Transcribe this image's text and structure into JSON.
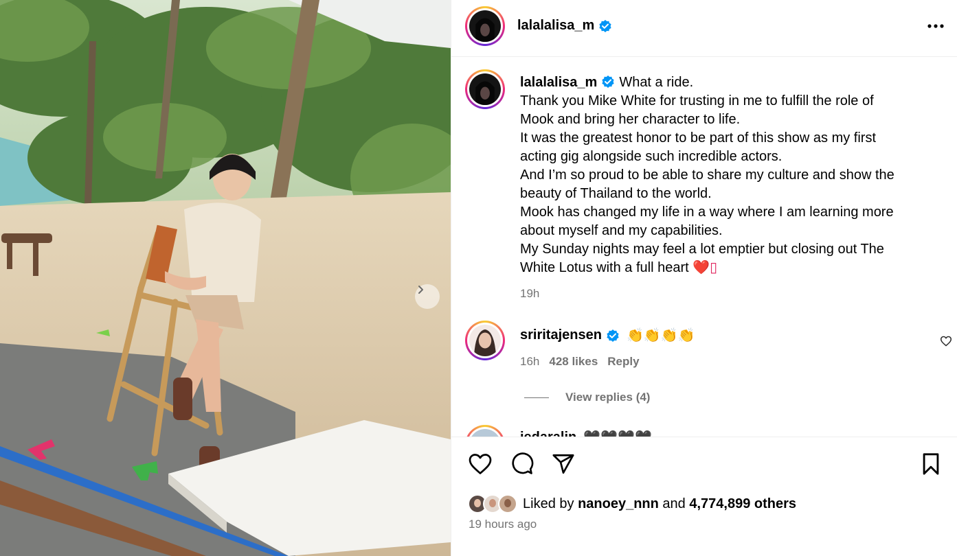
{
  "post": {
    "author": "lalalalisa_m",
    "caption_lines": [
      "What a ride.",
      "Thank you Mike White for trusting in me to fulfill the role of",
      "Mook and bring her character to life.",
      "It was the greatest honor to be part of this show as my first",
      "acting gig alongside such incredible actors.",
      "And I’m so proud to be able to share my culture and show the",
      "beauty of Thailand to the world.",
      "Mook has changed my life in a way where I am learning more",
      "about myself and my capabilities.",
      "My Sunday nights may feel a lot emptier but closing out The",
      "White Lotus with a full heart"
    ],
    "caption_tail": "❤️▯",
    "caption_time": "19h"
  },
  "comments": [
    {
      "username": "sriritajensen",
      "text": "👏👏👏👏",
      "time": "16h",
      "likes": "428 likes",
      "reply_label": "Reply",
      "view_replies": "View replies (4)"
    },
    {
      "username": "jedaralin",
      "text": "🖤🖤🖤🖤"
    }
  ],
  "footer": {
    "liked_by_prefix": "Liked by",
    "liked_by_user": "nanoey_nnn",
    "liked_by_and": "and",
    "liked_by_count": "4,774,899 others",
    "time_ago": "19 hours ago"
  },
  "icons": {
    "verified": "verified-badge-icon",
    "more": "more-options-icon",
    "like": "heart-icon",
    "comment": "comment-icon",
    "share": "share-icon",
    "save": "bookmark-icon",
    "next": "chevron-right-icon"
  },
  "colors": {
    "verified_blue": "#0095f6",
    "muted_text": "#737373",
    "heart_red": "#e0245e"
  }
}
